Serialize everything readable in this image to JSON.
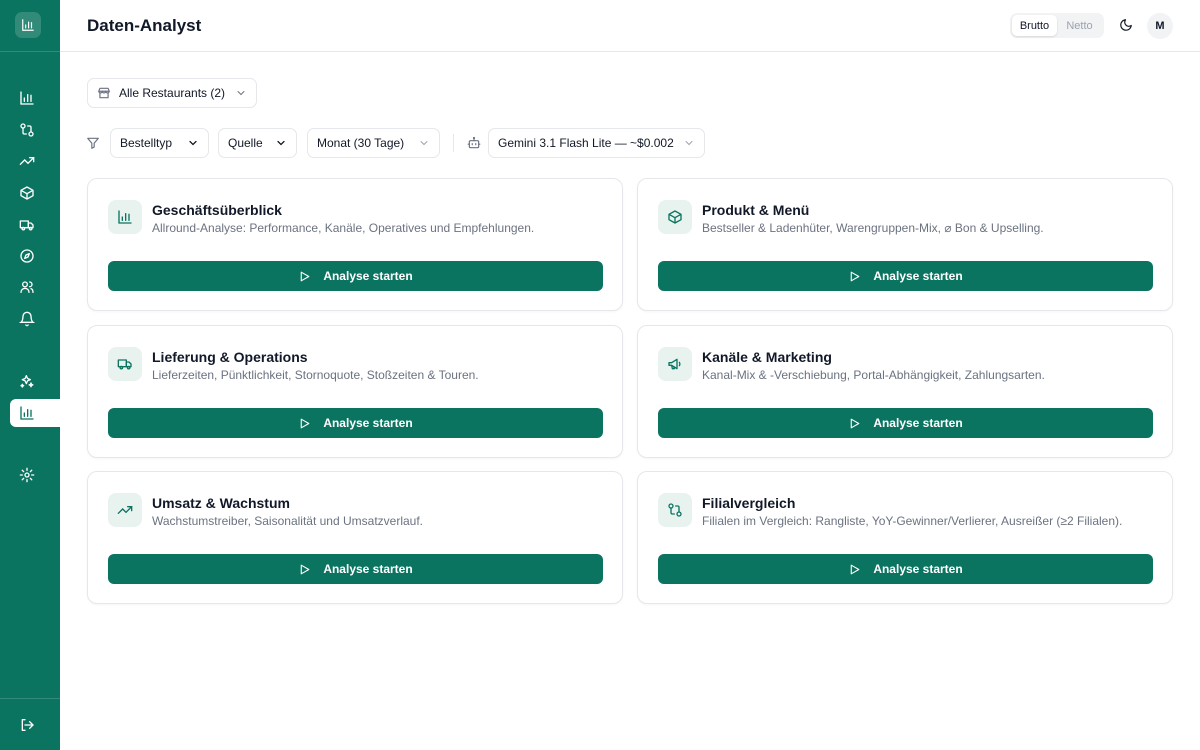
{
  "header": {
    "title": "Daten-Analyst",
    "toggle": {
      "options": [
        "Brutto",
        "Netto"
      ],
      "selected": "Brutto"
    },
    "avatar_initial": "M"
  },
  "filters": {
    "restaurant": "Alle Restaurants (2)",
    "order_type": "Bestelltyp",
    "source": "Quelle",
    "period": "Monat (30 Tage)",
    "model": "Gemini 3.1 Flash Lite — ~$0.002"
  },
  "sidebar": {
    "items": [
      {
        "icon": "bar-chart-icon"
      },
      {
        "icon": "git-compare-icon"
      },
      {
        "icon": "trending-up-icon"
      },
      {
        "icon": "package-icon"
      },
      {
        "icon": "truck-icon"
      },
      {
        "icon": "compass-icon"
      },
      {
        "icon": "users-icon"
      },
      {
        "icon": "bell-icon"
      },
      {
        "icon": "sparkles-icon"
      },
      {
        "icon": "bar-chart-icon",
        "active": true
      },
      {
        "icon": "gear-icon"
      },
      {
        "icon": "logout-icon"
      }
    ]
  },
  "cards": [
    {
      "title": "Geschäftsüberblick",
      "desc": "Allround-Analyse: Performance, Kanäle, Operatives und Empfehlungen.",
      "button": "Analyse starten",
      "icon": "bar-chart-icon"
    },
    {
      "title": "Produkt & Menü",
      "desc": "Bestseller & Ladenhüter, Warengruppen-Mix, ⌀ Bon & Upselling.",
      "button": "Analyse starten",
      "icon": "package-icon"
    },
    {
      "title": "Lieferung & Operations",
      "desc": "Lieferzeiten, Pünktlichkeit, Stornoquote, Stoßzeiten & Touren.",
      "button": "Analyse starten",
      "icon": "truck-icon"
    },
    {
      "title": "Kanäle & Marketing",
      "desc": "Kanal-Mix & -Verschiebung, Portal-Abhängigkeit, Zahlungsarten.",
      "button": "Analyse starten",
      "icon": "megaphone-icon"
    },
    {
      "title": "Umsatz & Wachstum",
      "desc": "Wachstumstreiber, Saisonalität und Umsatzverlauf.",
      "button": "Analyse starten",
      "icon": "trending-up-icon"
    },
    {
      "title": "Filialvergleich",
      "desc": "Filialen im Vergleich: Rangliste, YoY-Gewinner/Verlierer, Ausreißer (≥2 Filialen).",
      "button": "Analyse starten",
      "icon": "git-compare-icon"
    }
  ],
  "colors": {
    "primary": "#0b7460",
    "icon_bg": "#e8f3f0",
    "border": "#e5e7eb"
  }
}
